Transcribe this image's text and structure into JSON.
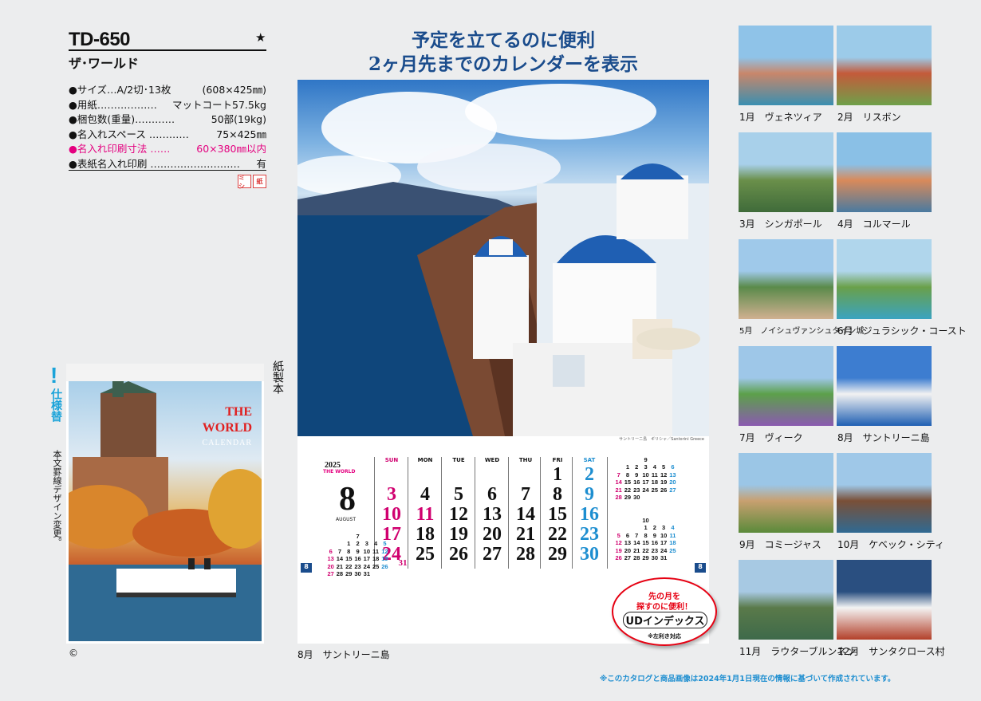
{
  "product": {
    "code": "TD-650",
    "star": "★",
    "name": "ザ･ワールド"
  },
  "specs": [
    {
      "label": "サイズ…A/2切･13枚",
      "value": "(608×425㎜)",
      "pink": false
    },
    {
      "label": "用紙………………",
      "value": "マットコート57.5kg",
      "pink": false
    },
    {
      "label": "梱包数(重量)…………",
      "value": "50部(19kg)",
      "pink": false
    },
    {
      "label": "名入れスペース …………",
      "value": "75×425㎜",
      "pink": false
    },
    {
      "label": "名入れ印刷寸法 ……",
      "value": "60×380㎜以内",
      "pink": true
    },
    {
      "label": "表紙名入れ印刷 ………………………",
      "value": "有",
      "pink": false
    }
  ],
  "badges": [
    "ミシ",
    "紙"
  ],
  "change_note": {
    "mark": "!",
    "title": "仕様替",
    "text": "本文罫線デザイン変更。"
  },
  "cover": {
    "title1": "THE",
    "title2": "WORLD",
    "title3": "CALENDAR"
  },
  "binding": "紙製本",
  "copyright": "©",
  "headline": {
    "line1": "予定を立てるのに便利",
    "line2": "2ヶ月先までのカレンダーを表示"
  },
  "photo_caption_right": "サントリーニ島　ギリシャ／Santorini  Greece",
  "calendar": {
    "year": "2025",
    "brand": "THE WORLD",
    "month": "8",
    "month_name": "AUGUST",
    "weekdays": [
      "SUN",
      "MON",
      "TUE",
      "WED",
      "THU",
      "FRI",
      "SAT"
    ],
    "index_label": "8",
    "prev_label": "7",
    "next1_label": "9",
    "next2_label": "10"
  },
  "ud_badge": {
    "line1": "先の月を",
    "line2": "探すのに便利！",
    "main": "UDインデックス",
    "note": "※左利き対応"
  },
  "main_caption": "8月　サントリーニ島",
  "thumbnails": [
    "1月　ヴェネツィア",
    "2月　リスボン",
    "3月　シンガポール",
    "4月　コルマール",
    "5月　ノイシュヴァンシュタイン城",
    "6月　ジュラシック・コースト",
    "7月　ヴィーク",
    "8月　サントリーニ島",
    "9月　コミージャス",
    "10月　ケベック・シティ",
    "11月　ラウターブルンネン",
    "12月　サンタクロース村"
  ],
  "footnote": "※このカタログと商品画像は2024年1月1日現在の情報に基づいて作成されています。",
  "colors": {
    "navy": "#1a4c8c",
    "pink": "#e4007f",
    "blue": "#1d8ed0",
    "red": "#e60012"
  }
}
